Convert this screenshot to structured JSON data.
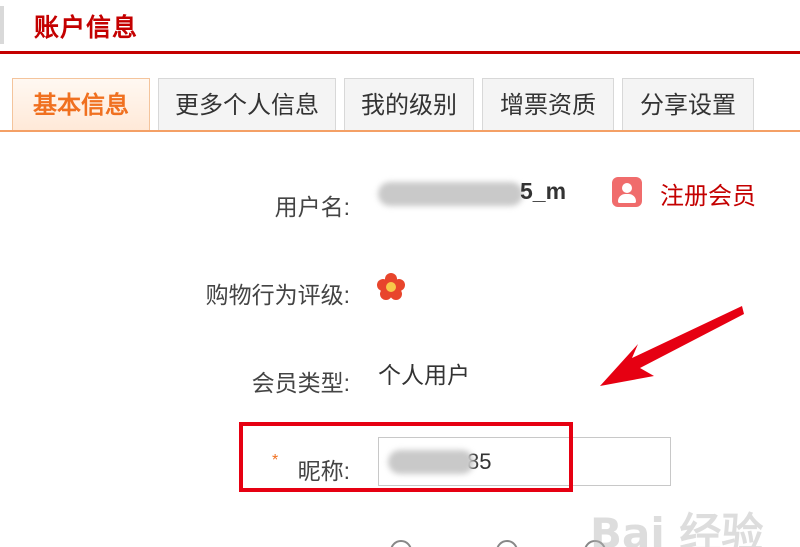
{
  "header": {
    "title": "账户信息"
  },
  "tabs": [
    {
      "label": "基本信息",
      "active": true
    },
    {
      "label": "更多个人信息",
      "active": false
    },
    {
      "label": "我的级别",
      "active": false
    },
    {
      "label": "增票资质",
      "active": false
    },
    {
      "label": "分享设置",
      "active": false
    }
  ],
  "form": {
    "username_label": "用户名:",
    "username_visible_suffix": "5_m",
    "register_link": "注册会员",
    "rating_label": "购物行为评级:",
    "member_type_label": "会员类型:",
    "member_type_value": "个人用户",
    "nickname_required_mark": "*",
    "nickname_label": "昵称:",
    "nickname_visible_suffix": "85"
  },
  "watermark": "Bai 经验",
  "colors": {
    "brand": "#c40000",
    "tab_active": "#f07020",
    "highlight": "#e60012"
  }
}
